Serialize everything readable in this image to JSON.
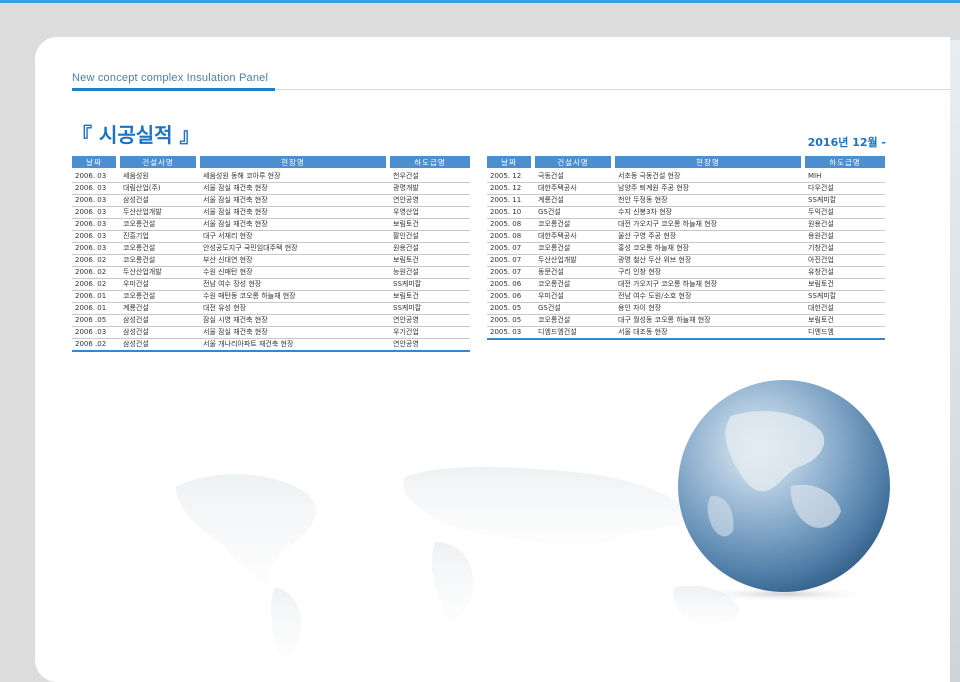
{
  "header": {
    "subtitle": "New concept complex Insulation Panel",
    "title": "『 시공실적 』",
    "date_range": "2016년 12월 -"
  },
  "table_headers": [
    "날짜",
    "건설사명",
    "현장명",
    "하도급명"
  ],
  "left_rows": [
    [
      "2006. 03",
      "세움성원",
      "세움성원 동해 코아루 현장",
      "천우건설"
    ],
    [
      "2006. 03",
      "대림산업(주)",
      "서울 잠실 재건축 현장",
      "광명개발"
    ],
    [
      "2006. 03",
      "삼성건설",
      "서울 잠실 재건축 현장",
      "연안공영"
    ],
    [
      "2006. 03",
      "두산산업개발",
      "서울 잠실 재건축 현장",
      "우영산업"
    ],
    [
      "2006. 03",
      "코오롱건설",
      "서울 잠실 재건축 현장",
      "보림토건"
    ],
    [
      "2006. 03",
      "진흥기업",
      "대구 서재리 현장",
      "팔인건설"
    ],
    [
      "2006. 03",
      "코오롱건설",
      "안성공도지구 국민임대주택 현장",
      "원용건설"
    ],
    [
      "2006. 02",
      "코오롱건설",
      "부산 신대연 현장",
      "보림토건"
    ],
    [
      "2006. 02",
      "두산산업개발",
      "수원 신매탄 현장",
      "능원건설"
    ],
    [
      "2006. 02",
      "우미건설",
      "전남 여수 장성 현장",
      "SS케미칼"
    ],
    [
      "2006. 01",
      "코오롱건설",
      "수원 매탄동 코오롱 하늘채 현장",
      "보림토건"
    ],
    [
      "2006. 01",
      "계룡건설",
      "대전 유성 현장",
      "SS케미칼"
    ],
    [
      "2006 .05",
      "삼성건설",
      "잠실 시영 재건축 현장",
      "연안공영"
    ],
    [
      "2006 .03",
      "삼성건설",
      "서울 잠실 재건축 현장",
      "우기건업"
    ],
    [
      "2006 .02",
      "삼성건설",
      "서울 개나리아파트 재건축 현장",
      "연안공영"
    ]
  ],
  "right_rows": [
    [
      "2005. 12",
      "극동건설",
      "서초동 극동건설 현장",
      "MIH"
    ],
    [
      "2005. 12",
      "대한주택공사",
      "남양주 퇴계원 주공 현장",
      "다우건설"
    ],
    [
      "2005. 11",
      "계룡건설",
      "천안 두정동 현장",
      "SS케미칼"
    ],
    [
      "2005. 10",
      "GS건설",
      "수지 신봉3차 현장",
      "두익건설"
    ],
    [
      "2005. 08",
      "코오롱건설",
      "대전 가오지구 코오롱 하늘채 현장",
      "원용건설"
    ],
    [
      "2005. 08",
      "대한주택공사",
      "울산 구영 주공 현장",
      "용원건설"
    ],
    [
      "2005. 07",
      "코오롱건설",
      "홍성 코오롱 하늘채 현장",
      "기창건설"
    ],
    [
      "2005. 07",
      "두산산업개발",
      "광명 철산 두산 위브 현장",
      "아진건업"
    ],
    [
      "2005. 07",
      "동문건설",
      "구리 인창 현장",
      "유창건설"
    ],
    [
      "2005. 06",
      "코오롱건설",
      "대전 가오지구 코오롱 하늘채 현장",
      "보림토건"
    ],
    [
      "2005. 06",
      "우미건설",
      "전남 여수 도원/소호 현장",
      "SS케미칼"
    ],
    [
      "2005. 05",
      "GS건설",
      "용인 자이 현장",
      "대한건설"
    ],
    [
      "2005. 05",
      "코오롱건설",
      "대구 월성동 코오롱 하늘채 현장",
      "보림토건"
    ],
    [
      "2005. 03",
      "디엠드엠건설",
      "서울 대조동 현장",
      "디엔드엠"
    ]
  ],
  "colors": {
    "accent": "#1a73c4",
    "table_header": "#4b8fd0",
    "top_bar": "#3aa0e0"
  },
  "decor": {
    "map": "world-map-illustration",
    "globe": "earth-globe-illustration"
  }
}
